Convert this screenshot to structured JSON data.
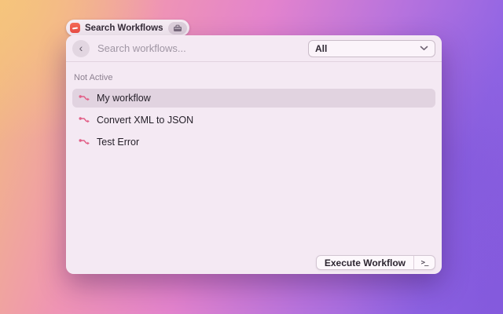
{
  "launcher_pill": {
    "label": "Search Workflows",
    "app_icon": "red-workflow-app-icon",
    "accessory_icon": "briefcase-icon"
  },
  "window": {
    "header": {
      "back_glyph": "‹",
      "search_placeholder": "Search workflows...",
      "search_value": "",
      "filter_dropdown": {
        "value": "All",
        "icon": "chevron-down-icon"
      }
    },
    "section": {
      "title": "Not Active"
    },
    "items": [
      {
        "label": "My workflow",
        "icon": "workflow-icon",
        "selected": true
      },
      {
        "label": "Convert XML to JSON",
        "icon": "workflow-icon",
        "selected": false
      },
      {
        "label": "Test Error",
        "icon": "workflow-icon",
        "selected": false
      }
    ],
    "footer": {
      "execute_label": "Execute Workflow",
      "shortcut_glyph": ">_"
    }
  },
  "colors": {
    "window_bg": "#f4e9f3",
    "accent_icon_pink": "#e25f87",
    "app_icon_red": "#ee4f45",
    "background_gradient": [
      "#f2bd7e",
      "#ef94b4",
      "#b873dd",
      "#8a5fe0"
    ]
  }
}
